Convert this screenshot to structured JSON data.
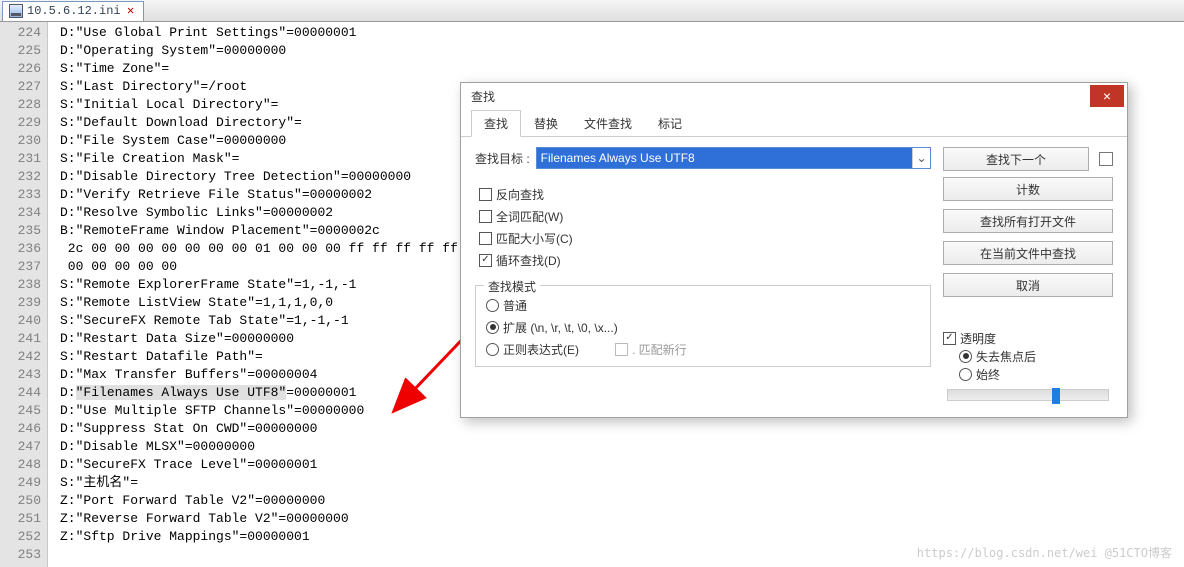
{
  "file_tab": {
    "name": "10.5.6.12.ini"
  },
  "line_start": 224,
  "code_lines": [
    "D:\"Use Global Print Settings\"=00000001",
    "D:\"Operating System\"=00000000",
    "S:\"Time Zone\"=",
    "S:\"Last Directory\"=/root",
    "S:\"Initial Local Directory\"=",
    "S:\"Default Download Directory\"=",
    "D:\"File System Case\"=00000000",
    "S:\"File Creation Mask\"=",
    "D:\"Disable Directory Tree Detection\"=00000000",
    "D:\"Verify Retrieve File Status\"=00000002",
    "D:\"Resolve Symbolic Links\"=00000002",
    "B:\"RemoteFrame Window Placement\"=0000002c",
    " 2c 00 00 00 00 00 00 00 01 00 00 00 ff ff ff ff ff ff ff ff ff ff ff ff ff ff ff ff 00 00 00 00 00 00 00 00 ff ff ff ff ff ff ff ff",
    " 00 00 00 00 00",
    "S:\"Remote ExplorerFrame State\"=1,-1,-1",
    "S:\"Remote ListView State\"=1,1,1,0,0",
    "S:\"SecureFX Remote Tab State\"=1,-1,-1",
    "D:\"Restart Data Size\"=00000000",
    "S:\"Restart Datafile Path\"=",
    "D:\"Max Transfer Buffers\"=00000004",
    "D:\"Filenames Always Use UTF8\"=00000001",
    "D:\"Use Multiple SFTP Channels\"=00000000",
    "D:\"Suppress Stat On CWD\"=00000000",
    "D:\"Disable MLSX\"=00000000",
    "D:\"SecureFX Trace Level\"=00000001",
    "S:\"主机名\"=",
    "Z:\"Port Forward Table V2\"=00000000",
    "Z:\"Reverse Forward Table V2\"=00000000",
    "Z:\"Sftp Drive Mappings\"=00000001",
    ""
  ],
  "highlight": {
    "line_index": 20,
    "text": "\"Filenames Always Use UTF8\""
  },
  "dialog": {
    "title": "查找",
    "tabs": [
      "查找",
      "替换",
      "文件查找",
      "标记"
    ],
    "active_tab": 0,
    "search_label": "查找目标 :",
    "search_value": "Filenames Always Use UTF8",
    "options": {
      "reverse": {
        "label": "反向查找",
        "checked": false
      },
      "whole_word": {
        "label": "全词匹配(W)",
        "checked": false
      },
      "match_case": {
        "label": "匹配大小写(C)",
        "checked": false
      },
      "wrap": {
        "label": "循环查找(D)",
        "checked": true
      }
    },
    "mode_group_title": "查找模式",
    "modes": {
      "normal": {
        "label": "普通",
        "selected": false
      },
      "extended": {
        "label": "扩展 (\\n, \\r, \\t, \\0, \\x...)",
        "selected": true
      },
      "regex": {
        "label": "正则表达式(E)",
        "selected": false
      }
    },
    "match_newline": {
      "label": ". 匹配新行",
      "checked": false
    },
    "buttons": {
      "find_next": "查找下一个",
      "count": "计数",
      "find_all_open": "查找所有打开文件",
      "find_all_current": "在当前文件中查找",
      "cancel": "取消"
    },
    "transparency": {
      "label": "透明度",
      "on_lose_focus": "失去焦点后",
      "always": "始终",
      "checked": true,
      "selected": "on_lose_focus"
    }
  },
  "watermark": "https://blog.csdn.net/wei @51CTO博客"
}
